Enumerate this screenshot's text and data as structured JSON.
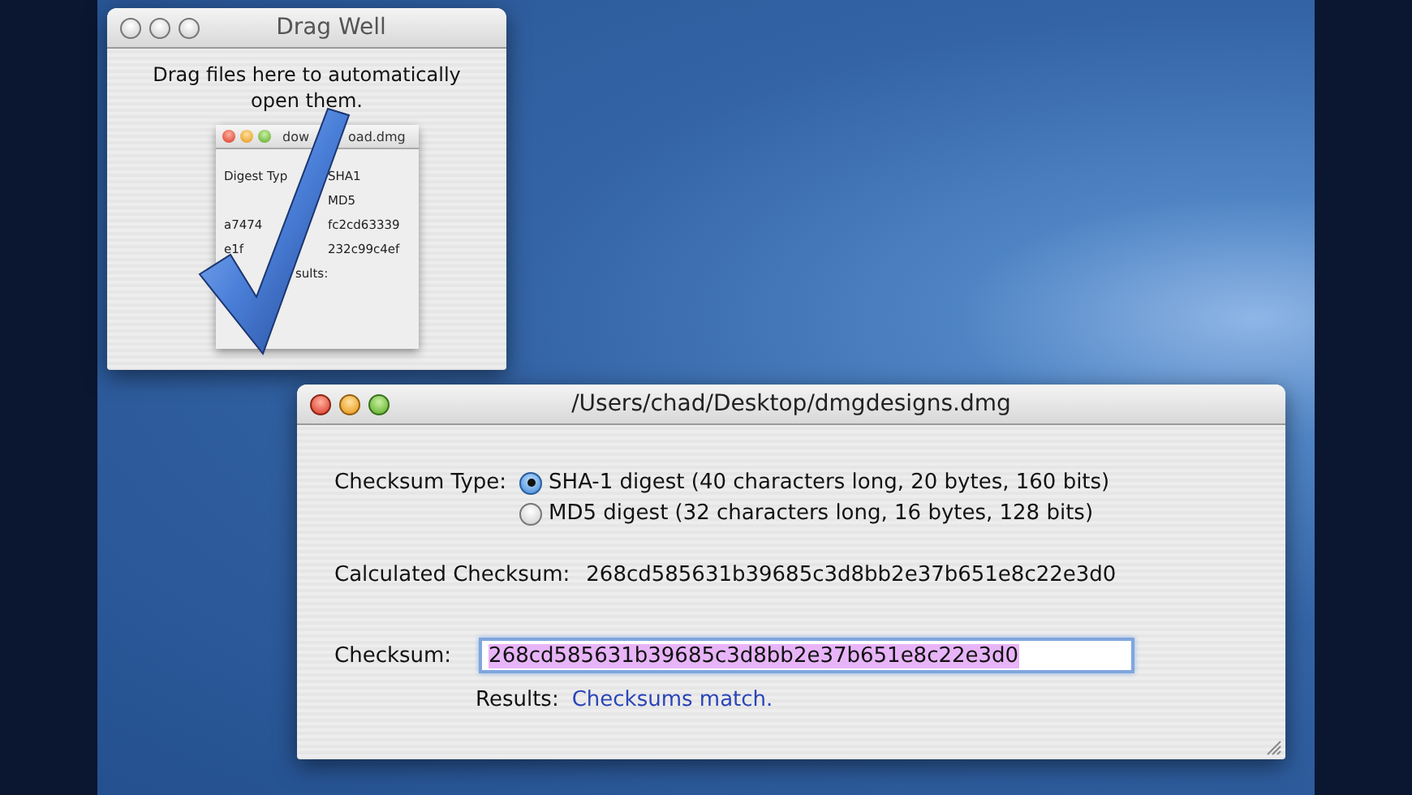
{
  "drag_well": {
    "title": "Drag Well",
    "message": "Drag files here to automatically open them.",
    "preview": {
      "title_parts": [
        "dow",
        "oad.dmg"
      ],
      "lines": [
        {
          "left": "Digest Typ",
          "right": "SHA1"
        },
        {
          "right": "MD5"
        },
        {
          "left": "a7474",
          "right": "fc2cd63339"
        },
        {
          "left": "e1f",
          "right": "232c99c4ef"
        },
        {
          "left": "sults:"
        }
      ]
    }
  },
  "main_window": {
    "title": "/Users/chad/Desktop/dmgdesigns.dmg",
    "checksum_type_label": "Checksum Type:",
    "options": [
      {
        "label": "SHA-1 digest (40 characters long, 20 bytes, 160 bits)",
        "selected": true
      },
      {
        "label": "MD5 digest (32 characters long, 16 bytes, 128 bits)",
        "selected": false
      }
    ],
    "calculated_label": "Calculated Checksum:",
    "calculated_value": "268cd585631b39685c3d8bb2e37b651e8c22e3d0",
    "checksum_label": "Checksum:",
    "checksum_value": "268cd585631b39685c3d8bb2e37b651e8c22e3d0",
    "checksum_value_selected": true,
    "results_label": "Results:",
    "results_value": "Checksums match."
  }
}
